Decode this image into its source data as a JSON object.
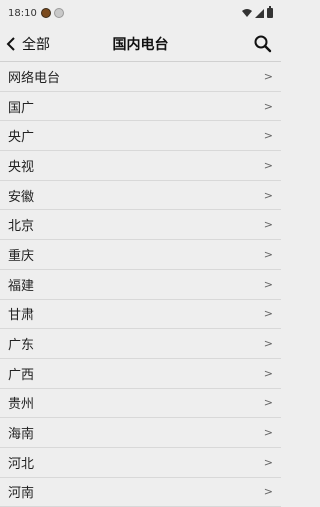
{
  "status_bar": {
    "time": "18:10"
  },
  "header": {
    "back_label": "全部",
    "title": "国内电台"
  },
  "list": {
    "chevron": ">",
    "items": [
      {
        "label": "网络电台"
      },
      {
        "label": "国广"
      },
      {
        "label": "央广"
      },
      {
        "label": "央视"
      },
      {
        "label": "安徽"
      },
      {
        "label": "北京"
      },
      {
        "label": "重庆"
      },
      {
        "label": "福建"
      },
      {
        "label": "甘肃"
      },
      {
        "label": "广东"
      },
      {
        "label": "广西"
      },
      {
        "label": "贵州"
      },
      {
        "label": "海南"
      },
      {
        "label": "河北"
      },
      {
        "label": "河南"
      }
    ]
  },
  "colors": {
    "background": "#eeeeee",
    "divider": "#d8d8d8",
    "text": "#222222"
  }
}
